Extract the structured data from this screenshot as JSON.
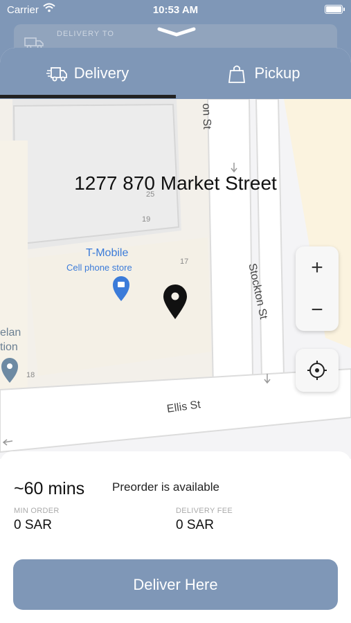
{
  "status_bar": {
    "carrier": "Carrier",
    "time": "10:53 AM"
  },
  "background_card": {
    "label": "DELIVERY TO"
  },
  "tabs": [
    {
      "label": "Delivery",
      "icon": "delivery-truck-icon",
      "active": true
    },
    {
      "label": "Pickup",
      "icon": "shopping-bag-icon",
      "active": false
    }
  ],
  "map": {
    "address": "1277 870 Market Street",
    "poi": {
      "name": "T-Mobile",
      "category": "Cell phone store"
    },
    "poi_left_partial": [
      "elan",
      "tion"
    ],
    "building_numbers": [
      "25",
      "19",
      "17",
      "18"
    ],
    "streets": {
      "vertical_main": "Stockton St",
      "vertical_top": "on St",
      "horizontal": "Ellis St"
    },
    "controls": {
      "zoom_in": "+",
      "zoom_out": "−"
    }
  },
  "info": {
    "eta": "~60 mins",
    "preorder": "Preorder is available",
    "min_order_label": "MIN ORDER",
    "min_order_value": "0 SAR",
    "delivery_fee_label": "DELIVERY FEE",
    "delivery_fee_value": "0 SAR",
    "cta_label": "Deliver Here"
  },
  "colors": {
    "accent": "#7f97b7",
    "map_bg": "#f4f4f6",
    "poi": "#3b7bd9"
  }
}
